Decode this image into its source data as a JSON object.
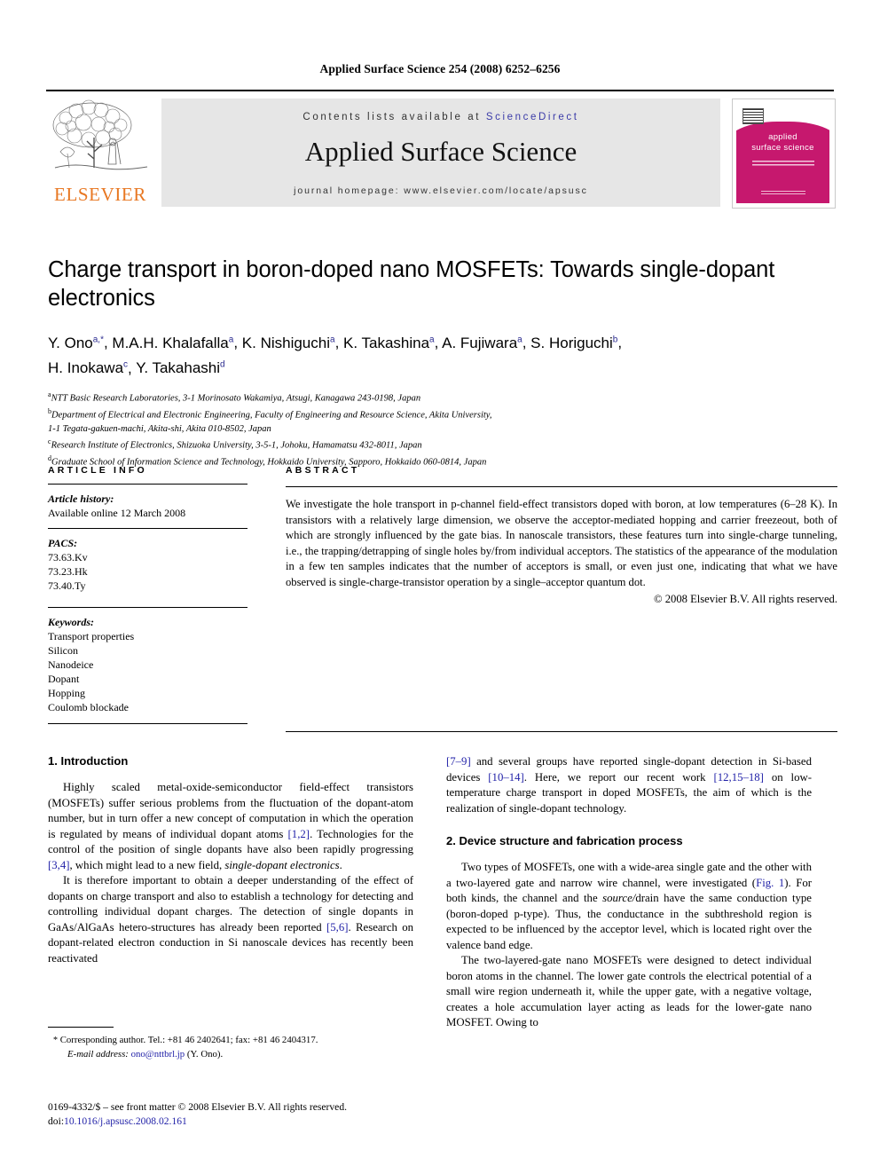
{
  "running_head": "Applied Surface Science 254 (2008) 6252–6256",
  "masthead": {
    "contents_prefix": "Contents lists available at ",
    "sciencedirect": "ScienceDirect",
    "journal_name": "Applied Surface Science",
    "homepage": "journal homepage: www.elsevier.com/locate/apsusc",
    "publisher_logo_text": "ELSEVIER",
    "cover_title_line1": "applied",
    "cover_title_line2": "surface science",
    "accent_orange": "#E87722",
    "accent_blue": "#3b3ba8",
    "cover_magenta": "#c6186e"
  },
  "title": "Charge transport in boron-doped nano MOSFETs: Towards single-dopant electronics",
  "authors": [
    {
      "name": "Y. Ono",
      "marks": "a,*"
    },
    {
      "name": "M.A.H. Khalafalla",
      "marks": "a"
    },
    {
      "name": "K. Nishiguchi",
      "marks": "a"
    },
    {
      "name": "K. Takashina",
      "marks": "a"
    },
    {
      "name": "A. Fujiwara",
      "marks": "a"
    },
    {
      "name": "S. Horiguchi",
      "marks": "b"
    },
    {
      "name": "H. Inokawa",
      "marks": "c"
    },
    {
      "name": "Y. Takahashi",
      "marks": "d"
    }
  ],
  "affiliations": [
    {
      "mark": "a",
      "text": "NTT Basic Research Laboratories, 3-1 Morinosato Wakamiya, Atsugi, Kanagawa 243-0198, Japan"
    },
    {
      "mark": "b",
      "text": "Department of Electrical and Electronic Engineering, Faculty of Engineering and Resource Science, Akita University,"
    },
    {
      "mark": "",
      "text": "1-1 Tegata-gakuen-machi, Akita-shi, Akita 010-8502, Japan"
    },
    {
      "mark": "c",
      "text": "Research Institute of Electronics, Shizuoka University, 3-5-1, Johoku, Hamamatsu 432-8011, Japan"
    },
    {
      "mark": "d",
      "text": "Graduate School of Information Science and Technology, Hokkaido University, Sapporo, Hokkaido 060-0814, Japan"
    }
  ],
  "article_info": {
    "heading": "ARTICLE INFO",
    "history_label": "Article history:",
    "history_value": "Available online 12 March 2008",
    "pacs_label": "PACS:",
    "pacs": [
      "73.63.Kv",
      "73.23.Hk",
      "73.40.Ty"
    ],
    "keywords_label": "Keywords:",
    "keywords": [
      "Transport properties",
      "Silicon",
      "Nanodeice",
      "Dopant",
      "Hopping",
      "Coulomb blockade"
    ]
  },
  "abstract": {
    "heading": "ABSTRACT",
    "text": "We investigate the hole transport in p-channel field-effect transistors doped with boron, at low temperatures (6–28 K). In transistors with a relatively large dimension, we observe the acceptor-mediated hopping and carrier freezeout, both of which are strongly influenced by the gate bias. In nanoscale transistors, these features turn into single-charge tunneling, i.e., the trapping/detrapping of single holes by/from individual acceptors. The statistics of the appearance of the modulation in a few ten samples indicates that the number of acceptors is small, or even just one, indicating that what we have observed is single-charge-transistor operation by a single–acceptor quantum dot.",
    "copyright": "© 2008 Elsevier B.V. All rights reserved."
  },
  "body": {
    "section1_title": "1. Introduction",
    "section1_p1_a": "Highly scaled metal-oxide-semiconductor field-effect transistors (MOSFETs) suffer serious problems from the fluctuation of the dopant-atom number, but in turn offer a new concept of computation in which the operation is regulated by means of individual dopant atoms ",
    "section1_p1_ref1": "[1,2]",
    "section1_p1_b": ". Technologies for the control of the position of single dopants have also been rapidly progressing ",
    "section1_p1_ref2": "[3,4]",
    "section1_p1_c": ", which might lead to a new field, ",
    "section1_p1_ital": "single-dopant electronics",
    "section1_p1_d": ".",
    "section1_p2_a": "It is therefore important to obtain a deeper understanding of the effect of dopants on charge transport and also to establish a technology for detecting and controlling individual dopant charges. The detection of single dopants in GaAs/AlGaAs hetero-structures has already been reported ",
    "section1_p2_ref1": "[5,6]",
    "section1_p2_b": ". Research on dopant-related electron conduction in Si nanoscale devices has recently been reactivated ",
    "section1_p2_ref2": "[7–9]",
    "section1_p2_c": " and several groups have reported single-dopant detection in Si-based devices ",
    "section1_p2_ref3": "[10–14]",
    "section1_p2_d": ". Here, we report our recent work ",
    "section1_p2_ref4": "[12,15–18]",
    "section1_p2_e": " on low-temperature charge transport in doped MOSFETs, the aim of which is the realization of single-dopant technology.",
    "section2_title": "2. Device structure and fabrication process",
    "section2_p1_a": "Two types of MOSFETs, one with a wide-area single gate and the other with a two-layered gate and narrow wire channel, were investigated (",
    "section2_p1_ref1": "Fig. 1",
    "section2_p1_b": "). For both kinds, the channel and the ",
    "section2_p1_ital": "source/",
    "section2_p1_c": "drain have the same conduction type (boron-doped p-type). Thus, the conductance in the subthreshold region is expected to be influenced by the acceptor level, which is located right over the valence band edge.",
    "section2_p2": "The two-layered-gate nano MOSFETs were designed to detect individual boron atoms in the channel. The lower gate controls the electrical potential of a small wire region underneath it, while the upper gate, with a negative voltage, creates a hole accumulation layer acting as leads for the lower-gate nano MOSFET. Owing to"
  },
  "footnote": {
    "star": "*",
    "corresponding": " Corresponding author. Tel.: +81 46 2402641; fax: +81 46 2404317.",
    "email_label": "E-mail address:",
    "email": "ono@nttbrl.jp",
    "email_suffix": " (Y. Ono)."
  },
  "footer": {
    "line1": "0169-4332/$ – see front matter © 2008 Elsevier B.V. All rights reserved.",
    "doi_label": "doi:",
    "doi_value": "10.1016/j.apsusc.2008.02.161"
  }
}
